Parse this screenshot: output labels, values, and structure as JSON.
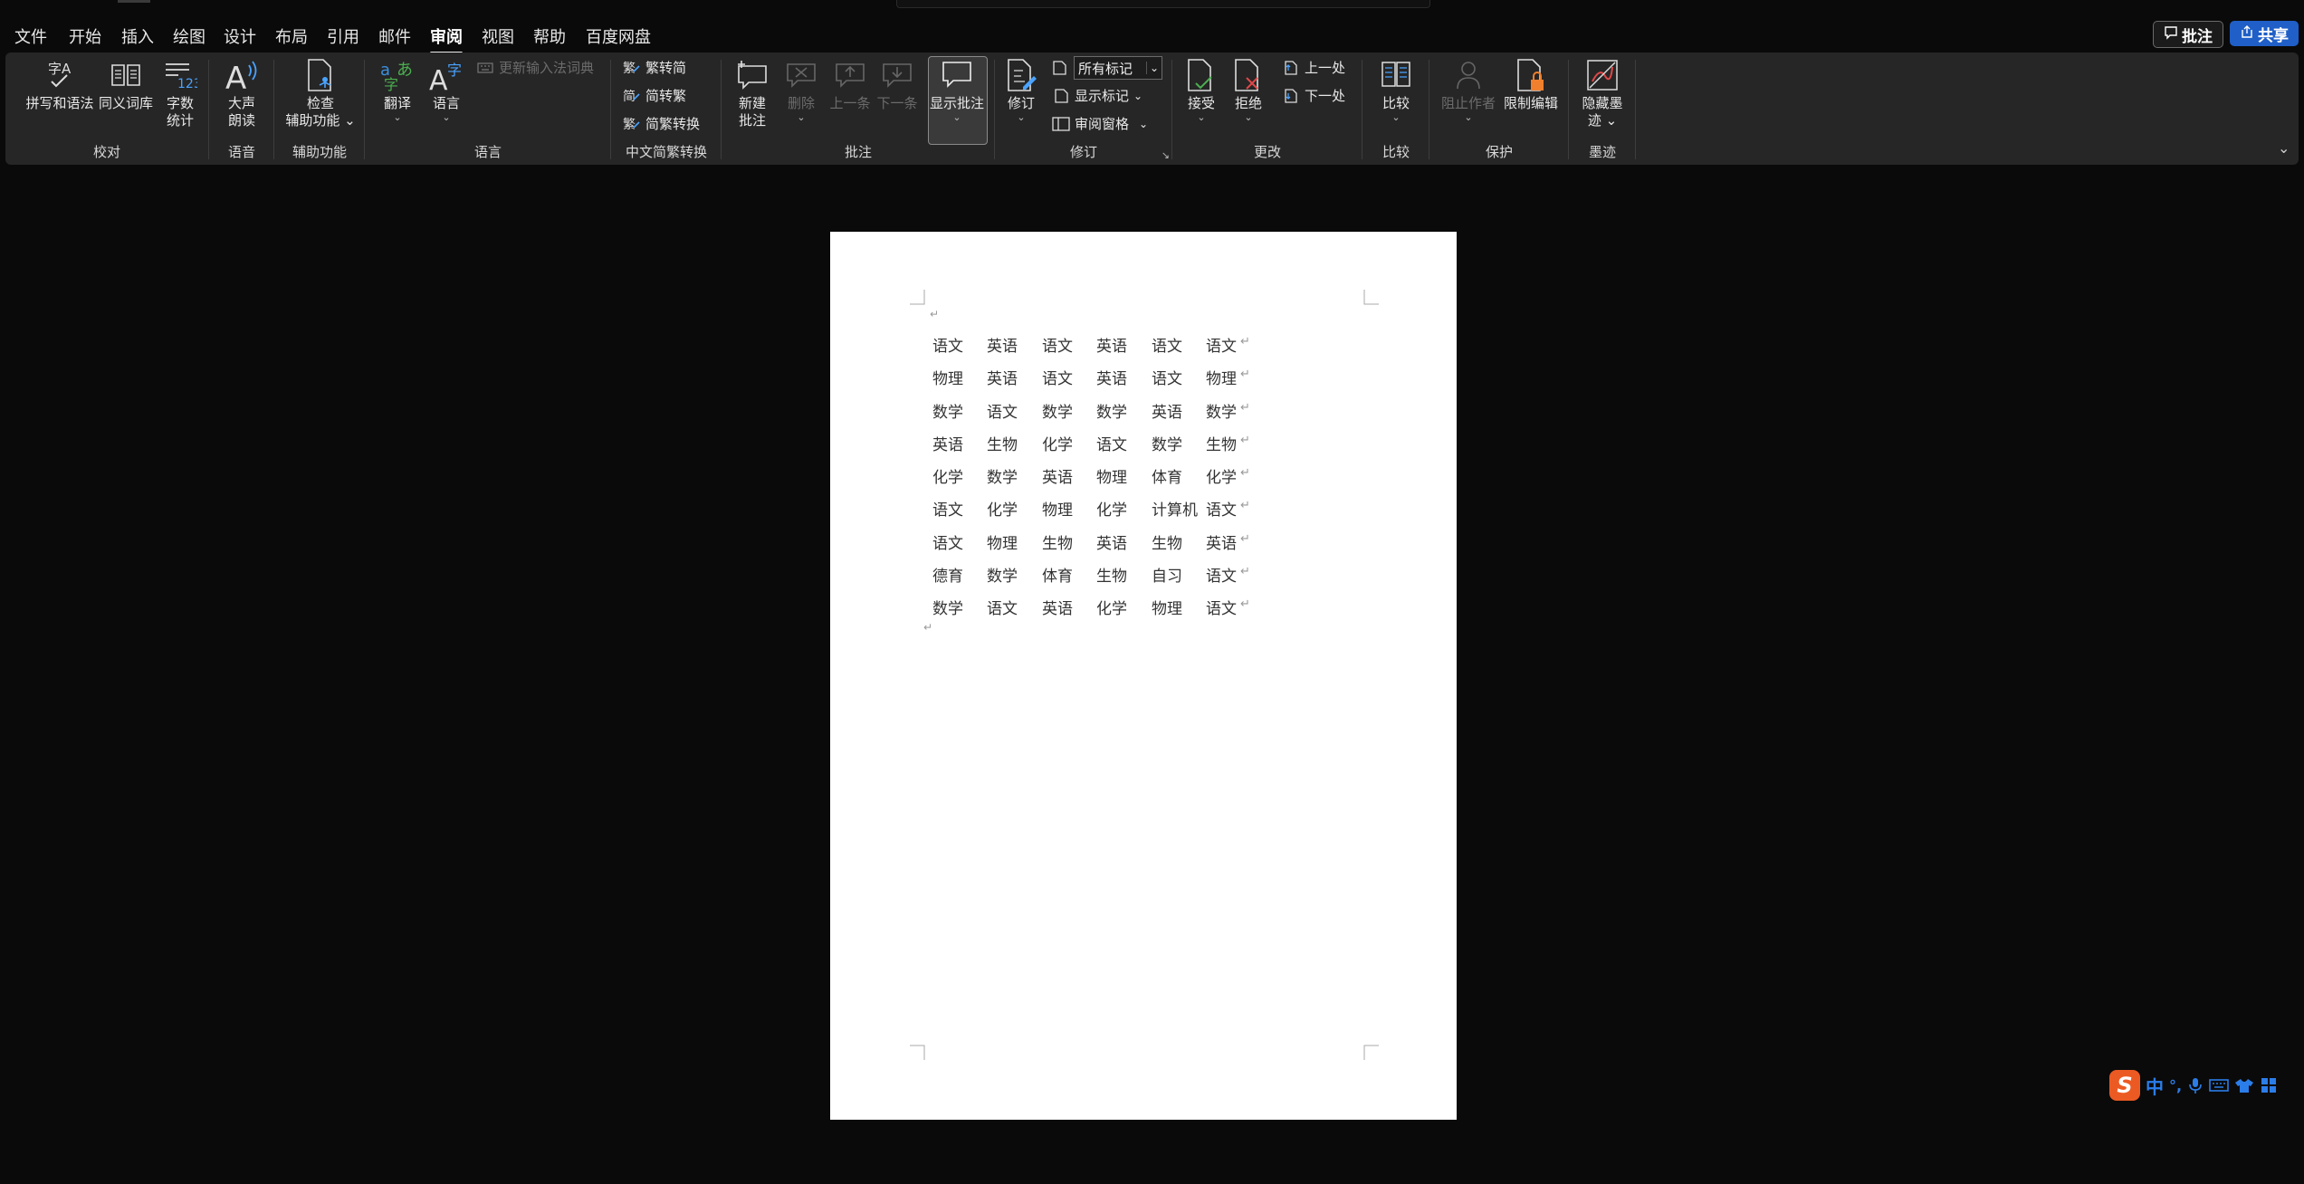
{
  "menu": {
    "items": [
      "文件",
      "开始",
      "插入",
      "绘图",
      "设计",
      "布局",
      "引用",
      "邮件",
      "审阅",
      "视图",
      "帮助",
      "百度网盘"
    ],
    "active": "审阅"
  },
  "header": {
    "comments_label": "批注",
    "share_label": "共享"
  },
  "ribbon": {
    "proofing": {
      "label": "校对",
      "spelling": "拼写和语法",
      "thesaurus": "同义词库",
      "wordcount_1": "字数",
      "wordcount_2": "统计"
    },
    "speech": {
      "label": "语音",
      "read_aloud_1": "大声",
      "read_aloud_2": "朗读"
    },
    "accessibility": {
      "label": "辅助功能",
      "check_1": "检查",
      "check_2": "辅助功能"
    },
    "language": {
      "label": "语言",
      "translate": "翻译",
      "language": "语言",
      "update_ime": "更新输入法词典"
    },
    "chinese_conversion": {
      "label": "中文简繁转换",
      "to_simplified": "繁转简",
      "to_traditional": "简转繁",
      "convert": "简繁转换"
    },
    "comments": {
      "label": "批注",
      "new_1": "新建",
      "new_2": "批注",
      "delete": "删除",
      "previous": "上一条",
      "next": "下一条",
      "show": "显示批注"
    },
    "tracking": {
      "label": "修订",
      "track": "修订",
      "markup_select": "所有标记",
      "show_markup": "显示标记",
      "reviewing_pane": "审阅窗格"
    },
    "changes": {
      "label": "更改",
      "accept": "接受",
      "reject": "拒绝",
      "previous": "上一处",
      "next": "下一处"
    },
    "compare": {
      "label": "比较",
      "compare": "比较"
    },
    "protect": {
      "label": "保护",
      "block_authors": "阻止作者",
      "restrict": "限制编辑"
    },
    "ink": {
      "label": "墨迹",
      "hide_ink_1": "隐藏墨",
      "hide_ink_2": "迹"
    }
  },
  "document": {
    "rows": [
      [
        "语文",
        "英语",
        "语文",
        "英语",
        "语文",
        "语文"
      ],
      [
        "物理",
        "英语",
        "语文",
        "英语",
        "语文",
        "物理"
      ],
      [
        "数学",
        "语文",
        "数学",
        "数学",
        "英语",
        "数学"
      ],
      [
        "英语",
        "生物",
        "化学",
        "语文",
        "数学",
        "生物"
      ],
      [
        "化学",
        "数学",
        "英语",
        "物理",
        "体育",
        "化学"
      ],
      [
        "语文",
        "化学",
        "物理",
        "化学",
        "计算机",
        "语文"
      ],
      [
        "语文",
        "物理",
        "生物",
        "英语",
        "生物",
        "英语"
      ],
      [
        "德育",
        "数学",
        "体育",
        "生物",
        "自习",
        "语文"
      ],
      [
        "数学",
        "语文",
        "英语",
        "化学",
        "物理",
        "语文"
      ]
    ]
  },
  "ime": {
    "mode": "中"
  }
}
